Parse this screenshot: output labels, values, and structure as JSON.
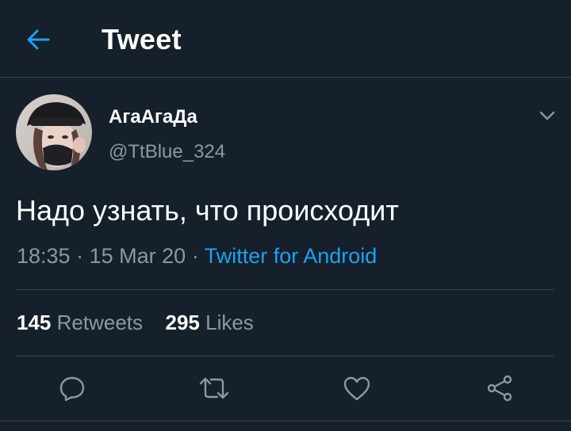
{
  "header": {
    "title": "Tweet",
    "back_icon": "arrow-left-icon"
  },
  "tweet": {
    "author": {
      "display_name": "АгаАгаДа",
      "handle": "@TtBlue_324"
    },
    "text": "Надо узнать, что происходит",
    "time": "18:35",
    "separator": "·",
    "date": "15 Mar 20",
    "source": "Twitter for Android",
    "stats": {
      "retweets_count": "145",
      "retweets_label": "Retweets",
      "likes_count": "295",
      "likes_label": "Likes"
    },
    "actions": [
      "reply-icon",
      "retweet-icon",
      "like-icon",
      "share-icon"
    ]
  },
  "colors": {
    "background": "#15202b",
    "accent": "#1da1f2",
    "secondary_text": "#8899a6",
    "divider": "#38444d"
  }
}
